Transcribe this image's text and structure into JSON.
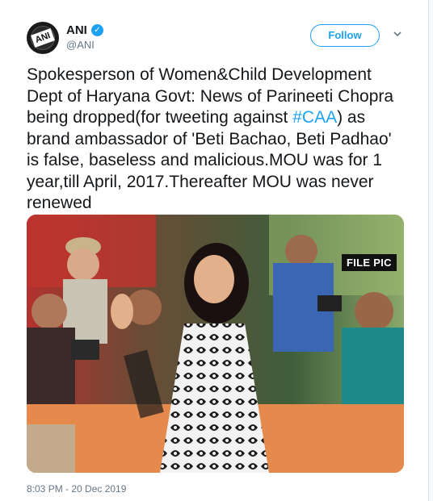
{
  "account": {
    "name": "ANI",
    "handle": "@ANI",
    "avatar_text": "ANI",
    "verified_icon": "verified-badge-icon"
  },
  "actions": {
    "follow_label": "Follow",
    "more_icon": "chevron-down-icon"
  },
  "tweet": {
    "text_before": "Spokesperson of Women&Child Development Dept of Haryana Govt: News of Parineeti Chopra being dropped(for tweeting against ",
    "hashtag": "#CAA",
    "text_after": ") as brand ambassador of 'Beti Bachao, Beti Padhao' is false, baseless and malicious.MOU was for 1 year,till April, 2017.Thereafter MOU was never renewed",
    "timestamp": "8:03 PM - 20 Dec 2019"
  },
  "media": {
    "badge": "FILE PIC"
  },
  "colors": {
    "accent": "#1da1f2",
    "text": "#14171a",
    "muted": "#657786"
  }
}
